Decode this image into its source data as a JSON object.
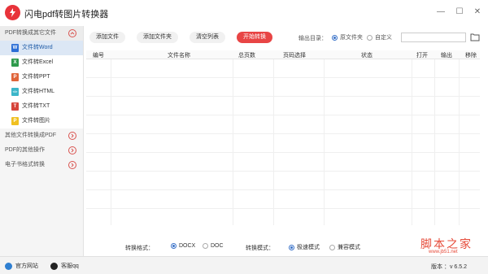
{
  "app": {
    "title": "闪电pdf转图片转换器"
  },
  "window_controls": {
    "minimize": "—",
    "maximize": "☐",
    "close": "✕"
  },
  "sidebar": {
    "sections": [
      {
        "label": "PDF转换成其它文件",
        "open": true
      },
      {
        "label": "其他文件转换成PDF",
        "open": false
      },
      {
        "label": "PDF的其他操作",
        "open": false
      },
      {
        "label": "电子书格式转换",
        "open": false
      }
    ],
    "items": [
      {
        "label": "文件转Word",
        "icon_letter": "W",
        "icon_color": "#2b6ed6",
        "active": true
      },
      {
        "label": "文件转Excel",
        "icon_letter": "X",
        "icon_color": "#2e9a4c"
      },
      {
        "label": "文件转PPT",
        "icon_letter": "P",
        "icon_color": "#e0653a"
      },
      {
        "label": "文件转HTML",
        "icon_letter": "</>",
        "icon_color": "#3cb6c9"
      },
      {
        "label": "文件转TXT",
        "icon_letter": "T",
        "icon_color": "#d6453b"
      },
      {
        "label": "文件转图片",
        "icon_letter": "P",
        "icon_color": "#f0c020"
      }
    ]
  },
  "toolbar": {
    "add_file": "添加文件",
    "add_folder": "添加文件夹",
    "clear_list": "清空列表",
    "start": "开始转换",
    "output_label": "输出目录：",
    "opt_source": "原文件夹",
    "opt_custom": "自定义",
    "path_value": ""
  },
  "table": {
    "headers": [
      "编号",
      "文件名称",
      "总页数",
      "页码选择",
      "状态",
      "打开",
      "输出",
      "移除"
    ]
  },
  "bottom": {
    "format_label": "转换格式：",
    "format_docx": "DOCX",
    "format_doc": "DOC",
    "mode_label": "转换模式：",
    "mode_fast": "极速模式",
    "mode_compat": "兼容模式"
  },
  "status": {
    "website": "官方网站",
    "service": "客服qq",
    "version": "版本 ：v 6.5.2"
  },
  "watermark": {
    "title": "脚本之家",
    "url": "www.jb51.net"
  },
  "colors": {
    "accent": "#e84545",
    "link_blue": "#1d5aa6",
    "brand_red": "#e8333a"
  }
}
